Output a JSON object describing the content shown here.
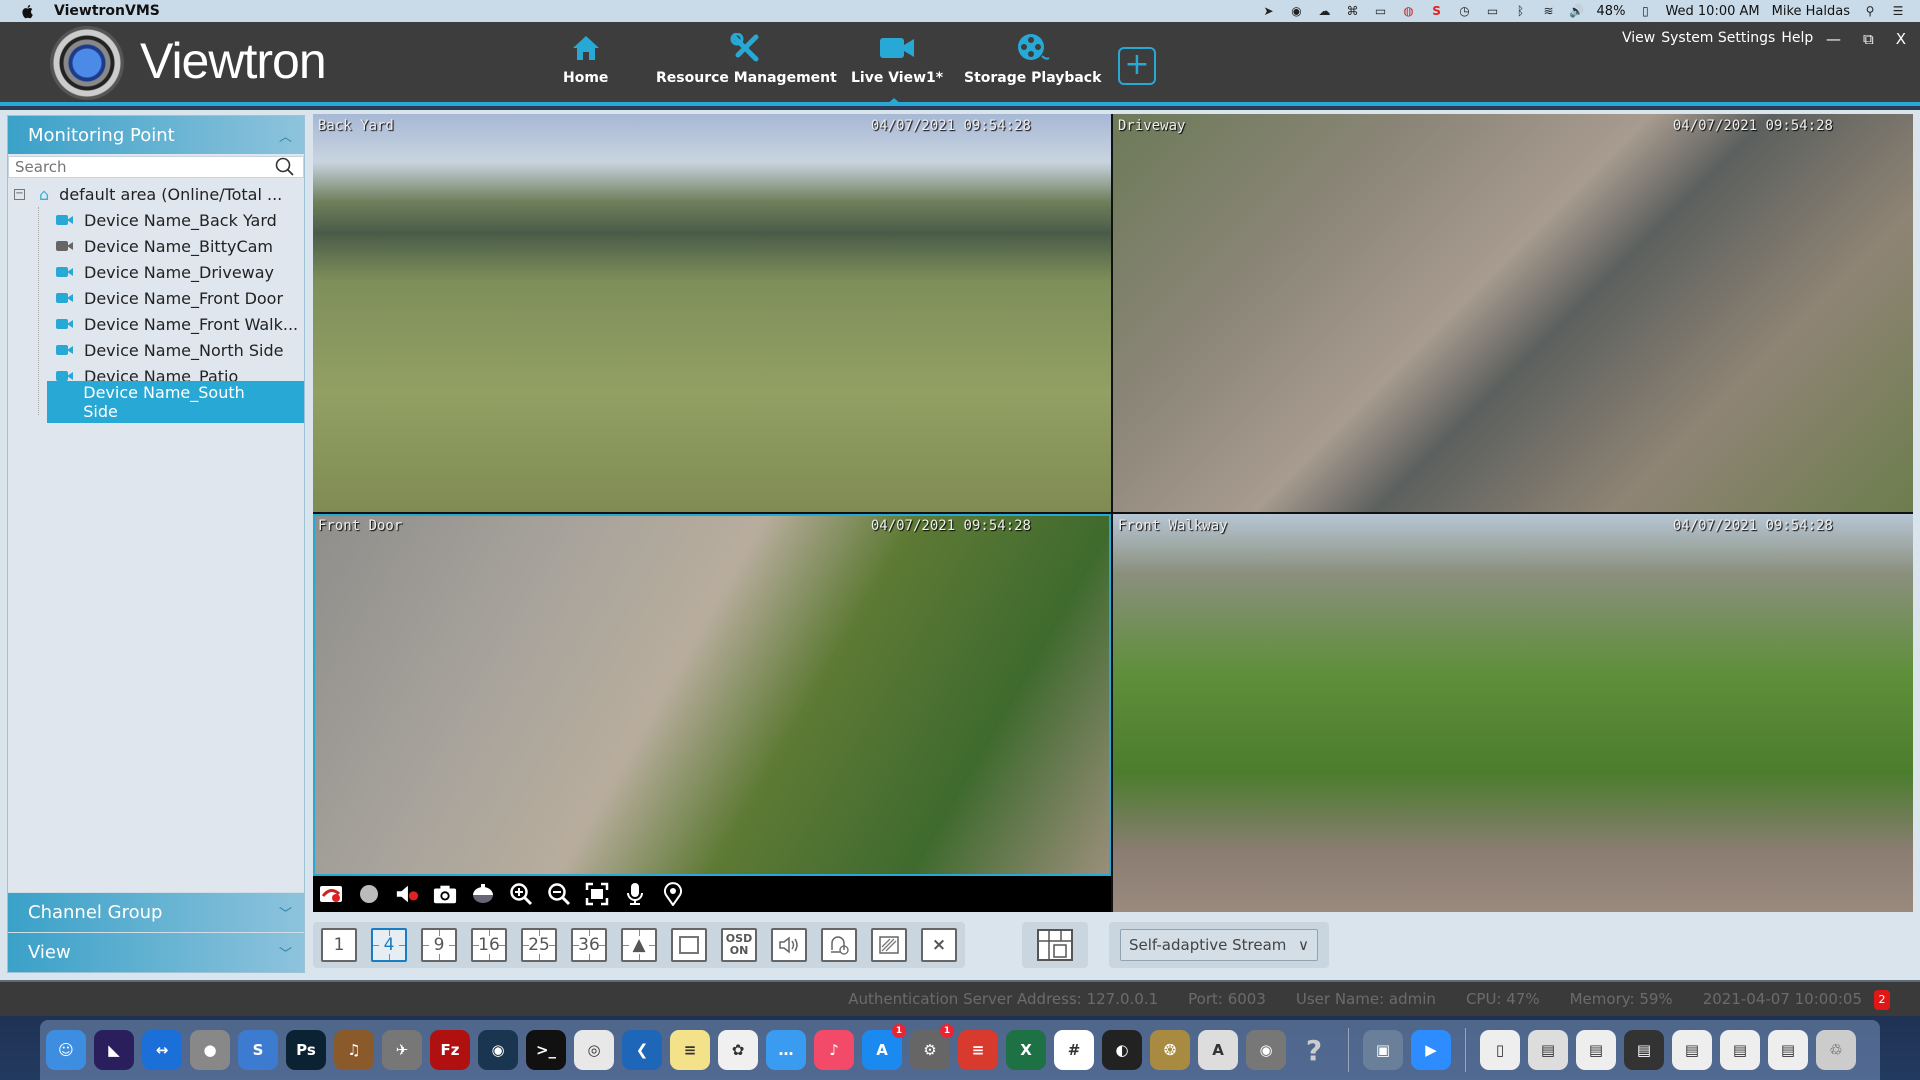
{
  "menubar": {
    "app_name": "ViewtronVMS",
    "battery": "48%",
    "clock": "Wed 10:00 AM",
    "user": "Mike Haldas",
    "status_icons": [
      "location-icon",
      "viewtron-icon",
      "cloud-upload-icon",
      "extension-icon",
      "screen-record-icon",
      "creative-cloud-icon",
      "snagit-icon",
      "time-machine-icon",
      "airplay-icon",
      "bluetooth-icon",
      "wifi-icon",
      "volume-icon",
      "battery-icon",
      "spotlight-icon",
      "notification-center-icon"
    ]
  },
  "app": {
    "brand": "Viewtron",
    "nav": [
      {
        "label": "Home",
        "icon": "home-icon"
      },
      {
        "label": "Resource Management",
        "icon": "tools-icon"
      },
      {
        "label": "Live View1*",
        "icon": "video-camera-icon",
        "active": true
      },
      {
        "label": "Storage Playback",
        "icon": "film-reel-icon"
      }
    ],
    "add_tab_label": "+",
    "system_menu": [
      "View",
      "System Settings",
      "Help"
    ],
    "window_controls": {
      "minimize": "—",
      "restore": "⧉",
      "close": "X"
    }
  },
  "sidebar": {
    "monitoring_point": {
      "title": "Monitoring Point",
      "search_placeholder": "Search",
      "root": {
        "label": "default area (Online/Total ...",
        "expander": "−"
      },
      "devices": [
        {
          "label": "Device Name_Back Yard",
          "online": true
        },
        {
          "label": "Device Name_BittyCam",
          "online": false
        },
        {
          "label": "Device Name_Driveway",
          "online": true
        },
        {
          "label": "Device Name_Front Door",
          "online": true
        },
        {
          "label": "Device Name_Front Walk...",
          "online": true
        },
        {
          "label": "Device Name_North Side",
          "online": true
        },
        {
          "label": "Device Name_Patio",
          "online": true
        },
        {
          "label": "Device Name_South Side",
          "online": true,
          "selected": true
        }
      ]
    },
    "channel_group": {
      "title": "Channel Group"
    },
    "view": {
      "title": "View"
    }
  },
  "video": {
    "tiles": [
      {
        "name": "Back Yard",
        "timestamp": "04/07/2021 09:54:28"
      },
      {
        "name": "Driveway",
        "timestamp": "04/07/2021 09:54:28"
      },
      {
        "name": "Front Door",
        "timestamp": "04/07/2021 09:54:28",
        "selected": true
      },
      {
        "name": "Front Walkway",
        "timestamp": "04/07/2021 09:54:28"
      }
    ],
    "tile_toolbar": [
      "stop-video-icon",
      "record-icon",
      "mute-icon",
      "snapshot-icon",
      "ptz-dome-icon",
      "zoom-in-icon",
      "zoom-out-icon",
      "fit-screen-icon",
      "microphone-icon",
      "location-pin-icon"
    ]
  },
  "bottom_toolbar": {
    "layouts": [
      {
        "label": "1"
      },
      {
        "label": "4",
        "active": true
      },
      {
        "label": "9"
      },
      {
        "label": "16"
      },
      {
        "label": "25"
      },
      {
        "label": "36"
      }
    ],
    "tools": [
      {
        "name": "sequence-icon",
        "glyph": "▲"
      },
      {
        "name": "fullscreen-icon"
      },
      {
        "name": "osd-toggle",
        "label_top": "OSD",
        "label_bottom": "ON"
      },
      {
        "name": "audio-icon",
        "glyph": "🔉"
      },
      {
        "name": "alarm-output-icon",
        "glyph": "⌂"
      },
      {
        "name": "mask-region-icon",
        "glyph": "▨"
      },
      {
        "name": "close-all-icon",
        "glyph": "×"
      }
    ],
    "stream": {
      "value": "Self-adaptive Stream"
    }
  },
  "status_bar": {
    "auth_server": "Authentication Server  Address: 127.0.0.1",
    "port": "Port: 6003",
    "user": "User Name: admin",
    "cpu": "CPU: 47%",
    "memory": "Memory: 59%",
    "datetime": "2021-04-07 10:00:05",
    "alarm_count": "2"
  },
  "dock": {
    "apps": [
      {
        "name": "finder",
        "color": "#3d8ee0",
        "glyph": "☺"
      },
      {
        "name": "premiere-encoder",
        "color": "#2a1e5c",
        "glyph": "◣"
      },
      {
        "name": "teamviewer",
        "color": "#1b6fd8",
        "glyph": "↔"
      },
      {
        "name": "photo-slideshow",
        "color": "#888",
        "glyph": "●"
      },
      {
        "name": "snagit",
        "color": "#3d7bd0",
        "glyph": "S"
      },
      {
        "name": "photoshop",
        "color": "#0b2233",
        "glyph": "Ps"
      },
      {
        "name": "garageband",
        "color": "#8a5a2a",
        "glyph": "♫"
      },
      {
        "name": "launchpad",
        "color": "#777",
        "glyph": "✈"
      },
      {
        "name": "filezilla",
        "color": "#b01010",
        "glyph": "Fz"
      },
      {
        "name": "viewtron-client",
        "color": "#1a3550",
        "glyph": "◉"
      },
      {
        "name": "terminal",
        "color": "#111",
        "glyph": ">_"
      },
      {
        "name": "chrome",
        "color": "#e8e8e8",
        "glyph": "◎"
      },
      {
        "name": "vscode",
        "color": "#1e66b8",
        "glyph": "❮"
      },
      {
        "name": "notes",
        "color": "#f4e28a",
        "glyph": "≡"
      },
      {
        "name": "photos",
        "color": "#f0f0f0",
        "glyph": "✿"
      },
      {
        "name": "messages",
        "color": "#3a9cf0",
        "glyph": "…"
      },
      {
        "name": "music",
        "color": "#f24a68",
        "glyph": "♪"
      },
      {
        "name": "app-store",
        "color": "#1a8af0",
        "glyph": "A",
        "badge": "1"
      },
      {
        "name": "system-preferences",
        "color": "#666",
        "glyph": "⚙",
        "badge": "1"
      },
      {
        "name": "todoist",
        "color": "#d83a2e",
        "glyph": "≡"
      },
      {
        "name": "excel",
        "color": "#1d7144",
        "glyph": "X"
      },
      {
        "name": "slack",
        "color": "#fff",
        "glyph": "#"
      },
      {
        "name": "obs",
        "color": "#222",
        "glyph": "◐"
      },
      {
        "name": "video-editor",
        "color": "#a88a40",
        "glyph": "❂"
      },
      {
        "name": "textedit",
        "color": "#ddd",
        "glyph": "A"
      },
      {
        "name": "viewtron-vms",
        "color": "#777",
        "glyph": "◉"
      },
      {
        "name": "help",
        "color": "transparent",
        "glyph": "?"
      },
      {
        "name": "preview",
        "color": "#6a7f9a",
        "glyph": "▣"
      },
      {
        "name": "zoom",
        "color": "#2d8cff",
        "glyph": "▶"
      },
      {
        "name": "iphone-mirror",
        "color": "#eee",
        "glyph": "▯"
      },
      {
        "name": "excel-window",
        "color": "#ddd",
        "glyph": "▤"
      },
      {
        "name": "document-window",
        "color": "#eee",
        "glyph": "▤"
      },
      {
        "name": "video-window",
        "color": "#333",
        "glyph": "▤"
      },
      {
        "name": "finder-window",
        "color": "#eee",
        "glyph": "▤"
      },
      {
        "name": "browser-window",
        "color": "#eee",
        "glyph": "▤"
      },
      {
        "name": "chrome-window",
        "color": "#eee",
        "glyph": "▤"
      },
      {
        "name": "trash",
        "color": "#ccc",
        "glyph": "♲"
      }
    ]
  }
}
